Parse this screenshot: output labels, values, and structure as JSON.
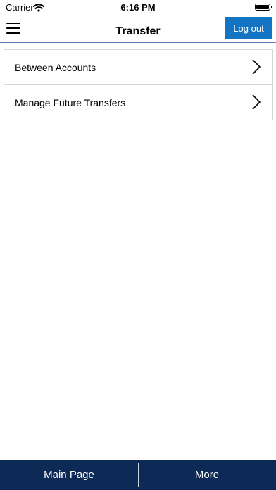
{
  "status_bar": {
    "carrier": "Carrier",
    "time": "6:16 PM",
    "wifi_icon": "wifi-icon",
    "battery_icon": "battery-icon"
  },
  "header": {
    "menu_icon": "hamburger-icon",
    "title": "Transfer",
    "logout_label": "Log out"
  },
  "transfer_menu": {
    "items": [
      {
        "label": "Between Accounts",
        "icon": "chevron-right-icon"
      },
      {
        "label": "Manage Future Transfers",
        "icon": "chevron-right-icon"
      }
    ]
  },
  "tab_bar": {
    "tabs": [
      {
        "label": "Main Page"
      },
      {
        "label": "More"
      }
    ]
  },
  "colors": {
    "primary_button": "#1474c4",
    "tab_bar_background": "#0d2a57",
    "header_divider": "#5b7fb8",
    "list_border": "#d6d6d6"
  }
}
